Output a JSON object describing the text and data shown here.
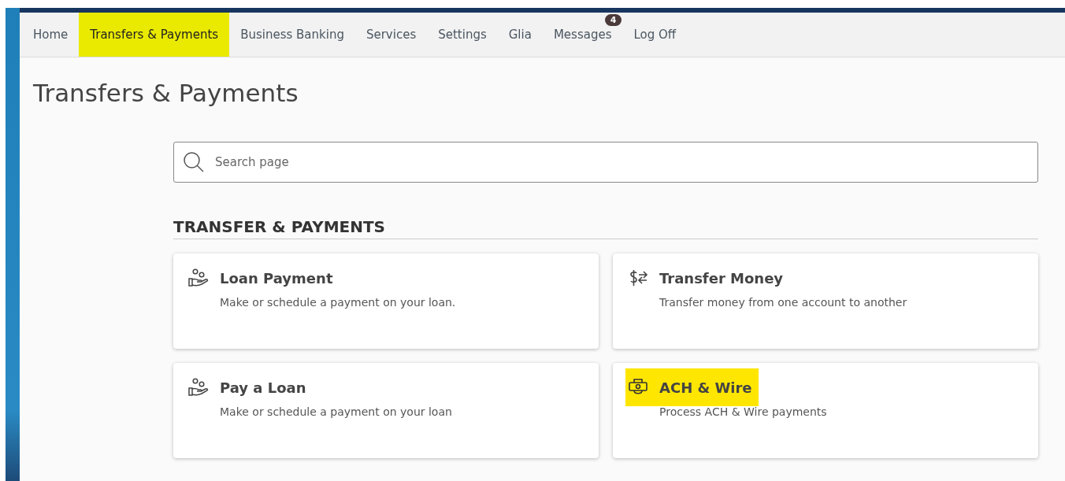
{
  "nav": {
    "items": [
      {
        "label": "Home",
        "selected": false
      },
      {
        "label": "Transfers & Payments",
        "selected": true
      },
      {
        "label": "Business Banking",
        "selected": false
      },
      {
        "label": "Services",
        "selected": false
      },
      {
        "label": "Settings",
        "selected": false
      },
      {
        "label": "Glia",
        "selected": false
      },
      {
        "label": "Messages",
        "selected": false,
        "badge": "4"
      },
      {
        "label": "Log Off",
        "selected": false
      }
    ]
  },
  "page_title": "Transfers & Payments",
  "search": {
    "placeholder": "Search page"
  },
  "section": {
    "heading": "TRANSFER & PAYMENTS",
    "cards": [
      {
        "kind": "loan",
        "title": "Loan Payment",
        "description": "Make or schedule a payment on your loan.",
        "highlighted": false
      },
      {
        "kind": "transfer",
        "title": "Transfer Money",
        "description": "Transfer money from one account to another",
        "highlighted": false
      },
      {
        "kind": "loan",
        "title": "Pay a Loan",
        "description": "Make or schedule a payment on your loan",
        "highlighted": false
      },
      {
        "kind": "wire",
        "title": "ACH & Wire",
        "description": "Process ACH & Wire payments",
        "highlighted": true
      }
    ]
  }
}
